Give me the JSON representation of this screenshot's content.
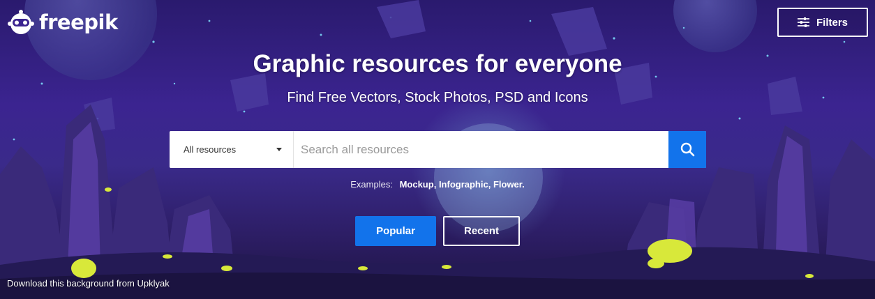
{
  "brand": {
    "name": "freepik"
  },
  "header": {
    "filters_label": "Filters"
  },
  "hero": {
    "title": "Graphic resources for everyone",
    "subtitle": "Find Free Vectors, Stock Photos, PSD and Icons"
  },
  "search": {
    "category": "All resources",
    "placeholder": "Search all resources",
    "value": ""
  },
  "examples": {
    "label": "Examples:",
    "items": [
      "Mockup,",
      "Infographic,",
      "Flower."
    ]
  },
  "buttons": {
    "popular": "Popular",
    "recent": "Recent"
  },
  "credit": {
    "prefix": "Download this background from",
    "author": "Upklyak"
  },
  "colors": {
    "accent": "#1273eb",
    "background": "#3b2490",
    "text": "#ffffff"
  },
  "icons": {
    "logo": "freepik-mascot-icon",
    "filters": "sliders-icon",
    "search": "magnifier-icon",
    "dropdown": "caret-down-icon"
  }
}
